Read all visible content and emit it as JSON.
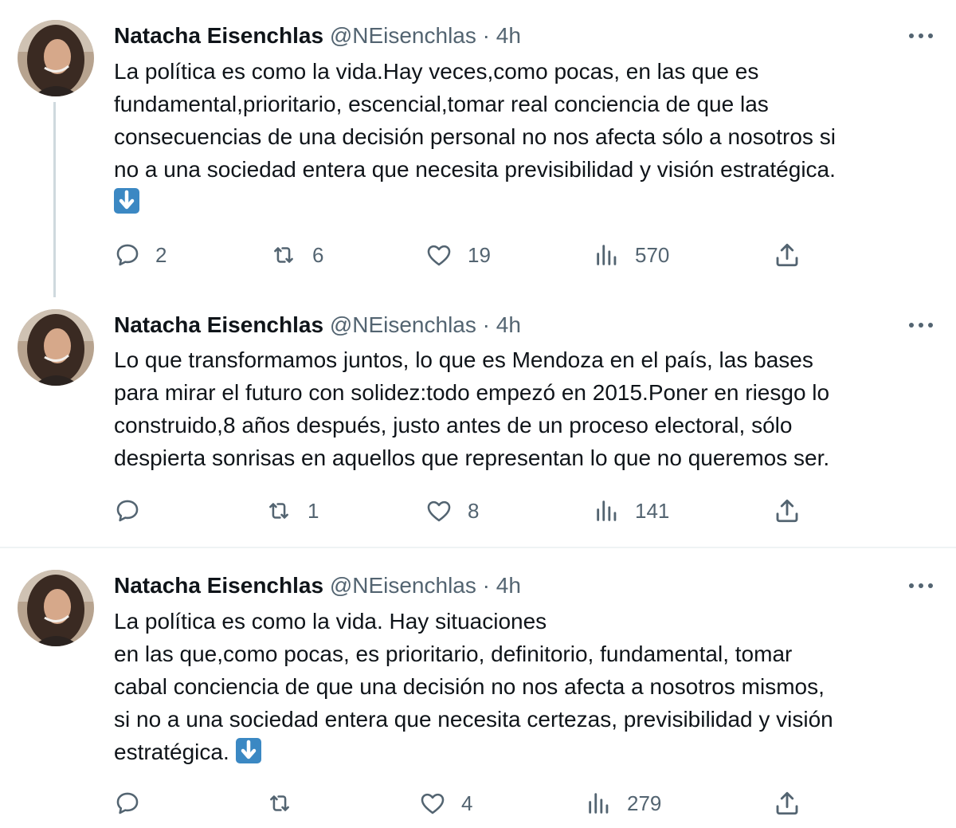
{
  "theme": {
    "text": "#0f1419",
    "secondary": "#536471",
    "thread_line": "#cfd9de",
    "divider": "#eff3f4",
    "emoji_bg": "#3b88c3"
  },
  "tweets": [
    {
      "author": {
        "name": "Natacha Eisenchlas",
        "handle": "@NEisenchlas",
        "separator": "·",
        "time": "4h"
      },
      "text": "La política es como la vida.Hay veces,como pocas, en las que es\nfundamental,prioritario, escencial,tomar real conciencia de que las\nconsecuencias de una decisión personal no nos afecta sólo a nosotros si\nno a una sociedad entera que necesita previsibilidad y visión estratégica.\n",
      "emoji": "arrow-down-emoji",
      "stats": {
        "replies": "2",
        "retweets": "6",
        "likes": "19",
        "views": "570"
      }
    },
    {
      "author": {
        "name": "Natacha Eisenchlas",
        "handle": "@NEisenchlas",
        "separator": "·",
        "time": "4h"
      },
      "text": "Lo que transformamos juntos, lo que es Mendoza en el país, las bases\npara mirar el futuro con solidez:todo empezó en 2015.Poner en riesgo lo\nconstruido,8 años después, justo antes de un proceso electoral, sólo\ndespierta sonrisas en aquellos que representan lo que no queremos ser.",
      "stats": {
        "replies": "",
        "retweets": "1",
        "likes": "8",
        "views": "141"
      }
    },
    {
      "author": {
        "name": "Natacha Eisenchlas",
        "handle": "@NEisenchlas",
        "separator": "·",
        "time": "4h"
      },
      "text": "La política es como la vida. Hay situaciones\nen las que,como pocas, es prioritario, definitorio, fundamental, tomar\ncabal conciencia de que una decisión no nos afecta a nosotros mismos,\nsi no a una sociedad entera que necesita certezas, previsibilidad y visión\nestratégica. ",
      "emoji": "arrow-down-emoji",
      "stats": {
        "replies": "",
        "retweets": "",
        "likes": "4",
        "views": "279"
      }
    }
  ]
}
